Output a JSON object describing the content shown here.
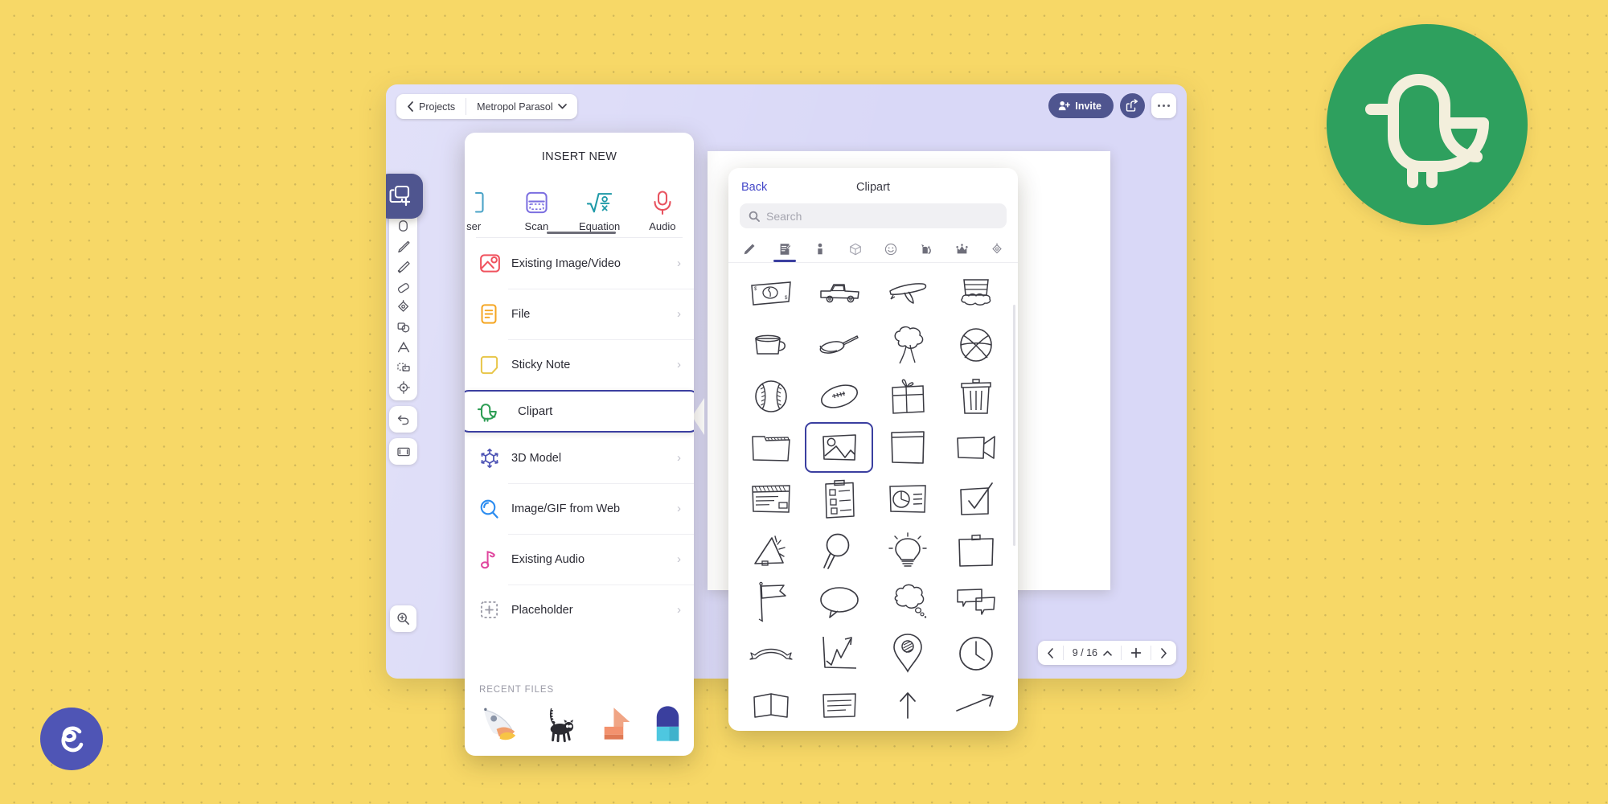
{
  "background": {
    "color": "#F7D867",
    "pattern": "dot-grid"
  },
  "app": {
    "window_bg": "#D9D8F7",
    "topbar": {
      "back_label": "Projects",
      "project_name": "Metropol Parasol",
      "project_chevron": "chevron-down",
      "invite_label": "Invite",
      "share_icon": "share-icon",
      "more_icon": "more-horizontal-icon"
    },
    "page_nav": {
      "prev_icon": "chevron-left",
      "page_indicator": "9 / 16",
      "expand_icon": "chevron-up",
      "add_icon": "plus",
      "next_icon": "chevron-right"
    },
    "left_toolbar": {
      "active_tool": "insert-new",
      "items": [
        {
          "name": "insert-new",
          "icon": "stack-plus-icon",
          "active": true
        },
        {
          "name": "hand",
          "icon": "hand-icon",
          "active": false
        },
        {
          "name": "pen",
          "icon": "pen-icon",
          "active": false
        },
        {
          "name": "highlighter",
          "icon": "highlighter-icon",
          "active": false
        },
        {
          "name": "eraser",
          "icon": "eraser-icon",
          "active": false
        },
        {
          "name": "fill",
          "icon": "paint-bucket-icon",
          "active": false
        },
        {
          "name": "shapes",
          "icon": "shapes-icon",
          "active": false
        },
        {
          "name": "text",
          "icon": "text-icon",
          "active": false
        },
        {
          "name": "select",
          "icon": "marquee-select-icon",
          "active": false
        },
        {
          "name": "laser",
          "icon": "target-icon",
          "active": false
        },
        {
          "name": "undo",
          "icon": "undo-arrow-icon",
          "active": false
        },
        {
          "name": "frame",
          "icon": "frame-icon",
          "active": false
        }
      ],
      "zoom_tool_icon": "magnifier-plus-icon"
    }
  },
  "insert_panel": {
    "title": "INSERT NEW",
    "quick_items": [
      {
        "label": "ser",
        "icon": "laser-icon",
        "color": "#4AA3C7",
        "clipped": true
      },
      {
        "label": "Scan",
        "icon": "scan-icon",
        "color": "#7C6FE0"
      },
      {
        "label": "Equation",
        "icon": "equation-icon",
        "color": "#1F9AA8"
      },
      {
        "label": "Audio",
        "icon": "microphone-icon",
        "color": "#E8535F"
      }
    ],
    "menu_items": [
      {
        "label": "Existing Image/Video",
        "icon": "image-video-icon",
        "color": "#F0525E",
        "arrow": "›",
        "selected": false
      },
      {
        "label": "File",
        "icon": "file-icon",
        "color": "#F5A623",
        "arrow": "›",
        "selected": false
      },
      {
        "label": "Sticky Note",
        "icon": "sticky-note-icon",
        "color": "#E8C64A",
        "arrow": "›",
        "selected": false
      },
      {
        "label": "Clipart",
        "icon": "bird-clipart-icon",
        "color": "#2E9E55",
        "arrow": "",
        "selected": true
      },
      {
        "label": "3D Model",
        "icon": "cube-3d-icon",
        "color": "#4F55B5",
        "arrow": "›",
        "selected": false
      },
      {
        "label": "Image/GIF from Web",
        "icon": "web-search-icon",
        "color": "#2B8CF0",
        "arrow": "›",
        "selected": false
      },
      {
        "label": "Existing Audio",
        "icon": "music-note-icon",
        "color": "#E0469E",
        "arrow": "›",
        "selected": false
      },
      {
        "label": "Placeholder",
        "icon": "placeholder-plus-icon",
        "color": "#9A9AA6",
        "arrow": "›",
        "selected": false
      }
    ],
    "recent_label": "RECENT FILES",
    "recent_files": [
      {
        "name": "rocket-thumbnail"
      },
      {
        "name": "lemur-thumbnail"
      },
      {
        "name": "orange-arrow-thumbnail"
      },
      {
        "name": "person-thumbnail"
      }
    ]
  },
  "clipart_panel": {
    "back_label": "Back",
    "title": "Clipart",
    "search_placeholder": "Search",
    "search_value": "",
    "search_icon": "search-icon",
    "accent_color": "#3B3FA0",
    "category_tabs": [
      {
        "name": "pencil-icon",
        "active": false
      },
      {
        "name": "notebook-icon",
        "active": true
      },
      {
        "name": "person-icon",
        "active": false
      },
      {
        "name": "cube-icon",
        "active": false
      },
      {
        "name": "smiley-icon",
        "active": false
      },
      {
        "name": "cat-icon",
        "active": false
      },
      {
        "name": "crown-icon",
        "active": false
      },
      {
        "name": "paint-bucket-icon",
        "active": false
      },
      {
        "name": "more-icon",
        "active": false
      }
    ],
    "grid_items": [
      {
        "name": "banknote-clipart",
        "selected": false
      },
      {
        "name": "pickup-truck-clipart",
        "selected": false
      },
      {
        "name": "airplane-clipart",
        "selected": false
      },
      {
        "name": "cupcake-clipart",
        "selected": false
      },
      {
        "name": "mug-clipart",
        "selected": false
      },
      {
        "name": "frying-pan-clipart",
        "selected": false
      },
      {
        "name": "tree-clipart",
        "selected": false
      },
      {
        "name": "basketball-clipart",
        "selected": false
      },
      {
        "name": "baseball-clipart",
        "selected": false
      },
      {
        "name": "football-clipart",
        "selected": false
      },
      {
        "name": "gift-box-clipart",
        "selected": false
      },
      {
        "name": "trash-can-clipart",
        "selected": false
      },
      {
        "name": "folder-clipart",
        "selected": false
      },
      {
        "name": "picture-clipart",
        "selected": true
      },
      {
        "name": "window-clipart",
        "selected": false
      },
      {
        "name": "video-camera-clipart",
        "selected": false
      },
      {
        "name": "browser-window-clipart",
        "selected": false
      },
      {
        "name": "checklist-clipboard-clipart",
        "selected": false
      },
      {
        "name": "pie-chart-slide-clipart",
        "selected": false
      },
      {
        "name": "checkmark-box-clipart",
        "selected": false
      },
      {
        "name": "megaphone-clipart",
        "selected": false
      },
      {
        "name": "magnifier-clipart",
        "selected": false
      },
      {
        "name": "lightbulb-clipart",
        "selected": false
      },
      {
        "name": "briefcase-clipart",
        "selected": false
      },
      {
        "name": "flag-clipart",
        "selected": false
      },
      {
        "name": "speech-bubble-clipart",
        "selected": false
      },
      {
        "name": "thought-bubble-clipart",
        "selected": false
      },
      {
        "name": "chat-bubbles-clipart",
        "selected": false
      },
      {
        "name": "banner-ribbon-clipart",
        "selected": false
      },
      {
        "name": "growth-chart-clipart",
        "selected": false
      },
      {
        "name": "map-pin-clipart",
        "selected": false
      },
      {
        "name": "clock-clipart",
        "selected": false
      },
      {
        "name": "book-clipart",
        "selected": false
      },
      {
        "name": "document-clipart",
        "selected": false
      },
      {
        "name": "arrow-up-clipart",
        "selected": false
      },
      {
        "name": "arrow-corner-clipart",
        "selected": false
      }
    ]
  },
  "canvas": {
    "drawing": "hand-drawn-picture-icon"
  },
  "branding": {
    "bird_logo": {
      "name": "bird-logo",
      "circle_color": "#2EA05E",
      "mark_color": "#F5F0DC"
    },
    "app_logo": {
      "name": "explain-everything-logo",
      "circle_color": "#4F55B5",
      "mark_color": "#FFFFFF"
    }
  }
}
